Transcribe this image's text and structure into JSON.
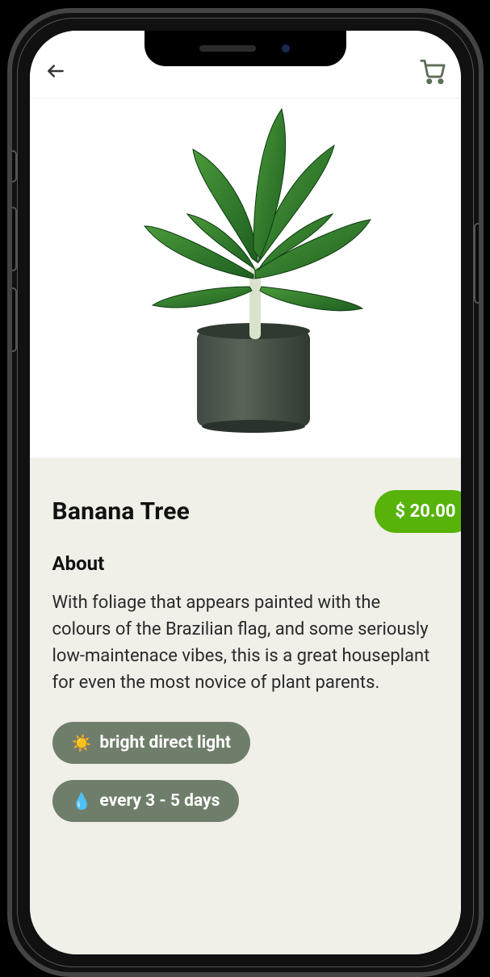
{
  "product": {
    "name": "Banana Tree",
    "price": "$ 20.00",
    "about_heading": "About",
    "about_text": "With foliage that appears painted with the colours of the Brazilian flag, and some seriously low-maintenace vibes, this is a great houseplant for even the most novice of plant parents."
  },
  "care_chips": [
    {
      "icon": "☀️",
      "label": "bright direct light"
    },
    {
      "icon": "💧",
      "label": "every 3 - 5 days"
    }
  ],
  "icons": {
    "back": "back-arrow-icon",
    "cart": "cart-icon"
  },
  "colors": {
    "accent_green": "#57b20a",
    "chip_olive": "#6f7e6a",
    "details_bg": "#f0efe8"
  }
}
